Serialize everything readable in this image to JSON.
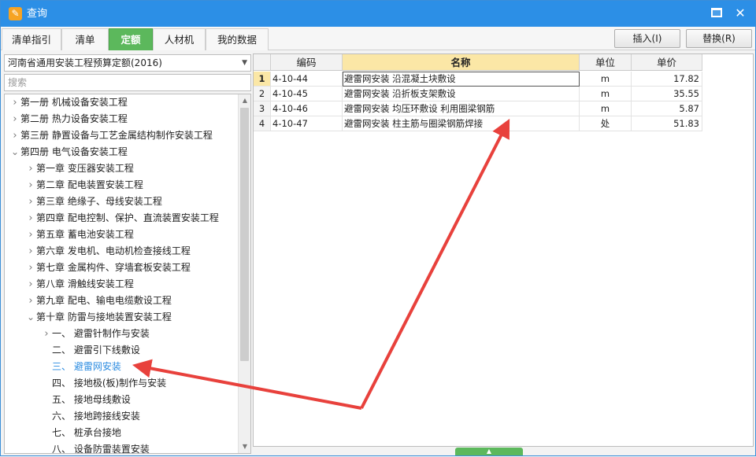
{
  "window": {
    "title": "查询"
  },
  "tabs": [
    {
      "label": "清单指引",
      "active": false
    },
    {
      "label": "清单",
      "active": false
    },
    {
      "label": "定额",
      "active": true
    },
    {
      "label": "人材机",
      "active": false
    },
    {
      "label": "我的数据",
      "active": false
    }
  ],
  "toolbar": {
    "insert_label": "插入(I)",
    "replace_label": "替换(R)"
  },
  "left": {
    "quota_selected": "河南省通用安装工程预算定额(2016)",
    "search_placeholder": "搜索",
    "tree": [
      {
        "label": "第一册 机械设备安装工程",
        "level": 0,
        "expand": "collapsed"
      },
      {
        "label": "第二册 热力设备安装工程",
        "level": 0,
        "expand": "collapsed"
      },
      {
        "label": "第三册 静置设备与工艺金属结构制作安装工程",
        "level": 0,
        "expand": "collapsed"
      },
      {
        "label": "第四册 电气设备安装工程",
        "level": 0,
        "expand": "expanded"
      },
      {
        "label": "第一章 变压器安装工程",
        "level": 1,
        "expand": "collapsed"
      },
      {
        "label": "第二章 配电装置安装工程",
        "level": 1,
        "expand": "collapsed"
      },
      {
        "label": "第三章 绝缘子、母线安装工程",
        "level": 1,
        "expand": "collapsed"
      },
      {
        "label": "第四章 配电控制、保护、直流装置安装工程",
        "level": 1,
        "expand": "collapsed"
      },
      {
        "label": "第五章 蓄电池安装工程",
        "level": 1,
        "expand": "collapsed"
      },
      {
        "label": "第六章 发电机、电动机检查接线工程",
        "level": 1,
        "expand": "collapsed"
      },
      {
        "label": "第七章 金属构件、穿墙套板安装工程",
        "level": 1,
        "expand": "collapsed"
      },
      {
        "label": "第八章 滑触线安装工程",
        "level": 1,
        "expand": "collapsed"
      },
      {
        "label": "第九章 配电、输电电缆敷设工程",
        "level": 1,
        "expand": "collapsed"
      },
      {
        "label": "第十章 防雷与接地装置安装工程",
        "level": 1,
        "expand": "expanded"
      },
      {
        "label": "一、 避雷针制作与安装",
        "level": 2,
        "expand": "collapsed"
      },
      {
        "label": "二、 避雷引下线敷设",
        "level": 2,
        "expand": "none"
      },
      {
        "label": "三、 避雷网安装",
        "level": 2,
        "expand": "none",
        "selected": true
      },
      {
        "label": "四、 接地极(板)制作与安装",
        "level": 2,
        "expand": "none"
      },
      {
        "label": "五、 接地母线敷设",
        "level": 2,
        "expand": "none"
      },
      {
        "label": "六、 接地跨接线安装",
        "level": 2,
        "expand": "none"
      },
      {
        "label": "七、 桩承台接地",
        "level": 2,
        "expand": "none"
      },
      {
        "label": "八、 设备防雷装置安装",
        "level": 2,
        "expand": "none"
      }
    ]
  },
  "grid": {
    "headers": {
      "code": "编码",
      "name": "名称",
      "unit": "单位",
      "price": "单价"
    },
    "rows": [
      {
        "idx": "1",
        "code": "4-10-44",
        "name": "避雷网安装 沿混凝土块敷设",
        "unit": "m",
        "price": "17.82"
      },
      {
        "idx": "2",
        "code": "4-10-45",
        "name": "避雷网安装 沿折板支架敷设",
        "unit": "m",
        "price": "35.55"
      },
      {
        "idx": "3",
        "code": "4-10-46",
        "name": "避雷网安装 均压环敷设 利用圈梁钢筋",
        "unit": "m",
        "price": "5.87"
      },
      {
        "idx": "4",
        "code": "4-10-47",
        "name": "避雷网安装 柱主筋与圈梁钢筋焊接",
        "unit": "处",
        "price": "51.83"
      }
    ]
  },
  "colors": {
    "titlebar": "#2c8fe6",
    "active_tab": "#5cb85c",
    "selected_text": "#2a8be0",
    "arrow": "#e8413c",
    "name_header": "#fbe7a6"
  }
}
